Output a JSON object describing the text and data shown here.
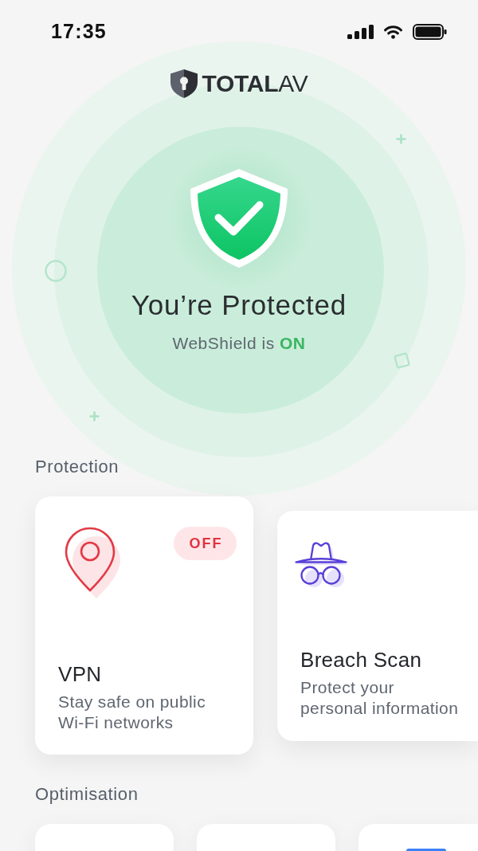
{
  "status_bar": {
    "time": "17:35"
  },
  "header": {
    "logo": "**TOTAL**AV"
  },
  "hero": {
    "title": "You’re Protected",
    "webshield": {
      "label": "WebShield is",
      "value": "ON",
      "on": true
    }
  },
  "protection": {
    "heading": "Protection",
    "cards": [
      {
        "kind": "vpn",
        "selected": true,
        "title": "VPN",
        "description": "Stay safe on public Wi-Fi networks",
        "badge": {
          "text": "OFF",
          "on": false
        }
      },
      {
        "kind": "breach_scan",
        "selected": false,
        "title": "Breach Scan",
        "description": "Protect your personal information"
      }
    ]
  },
  "optimisation": {
    "heading": "Optimisation"
  }
}
